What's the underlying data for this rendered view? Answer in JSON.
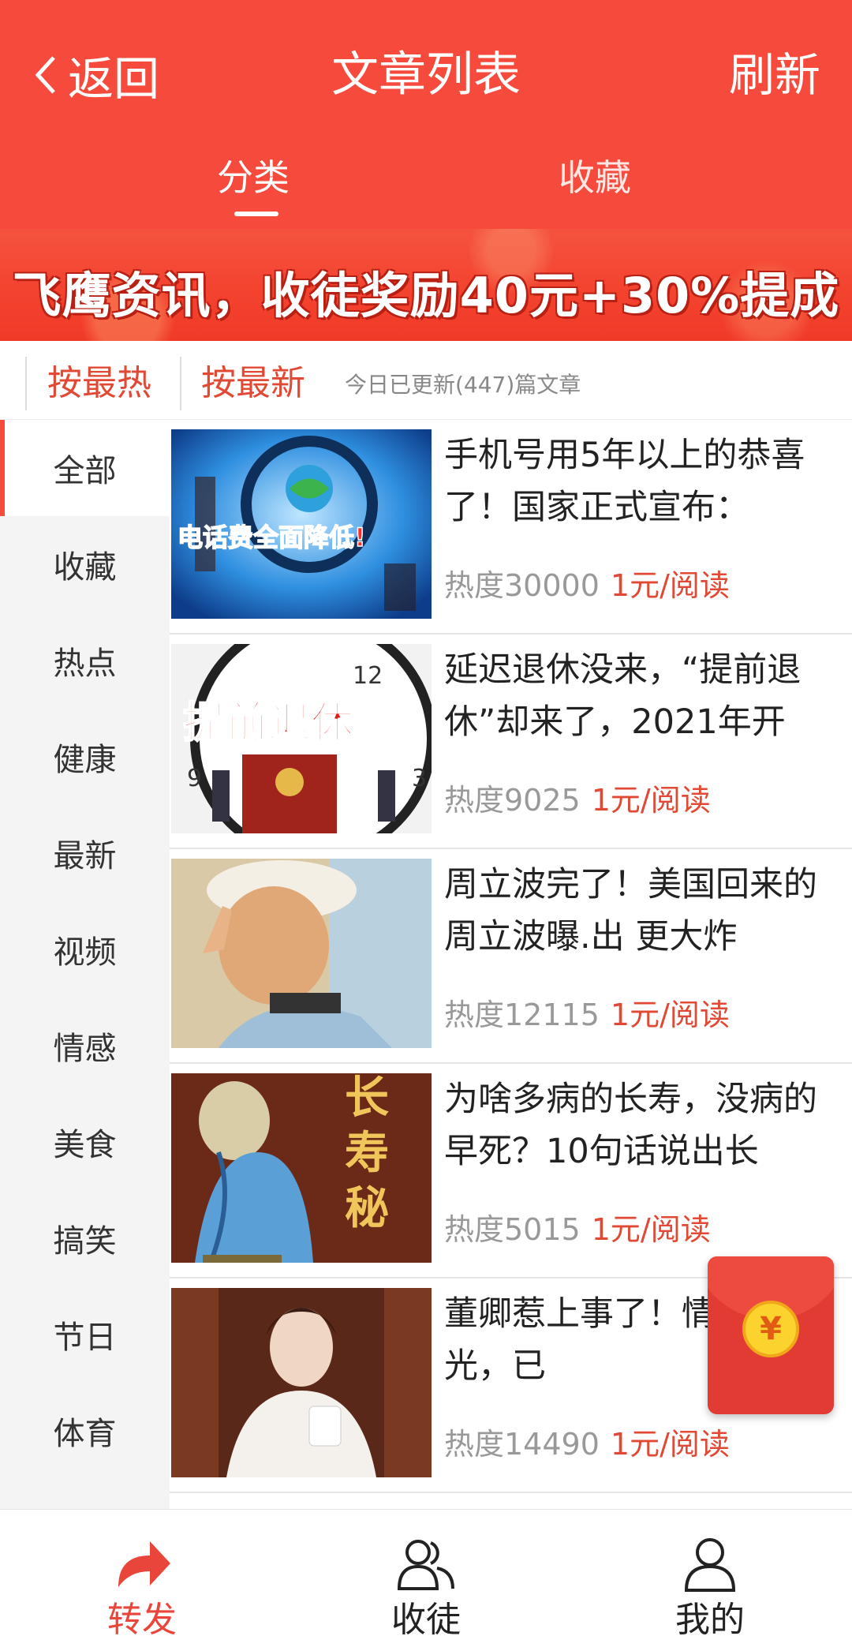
{
  "header": {
    "back_label": "返回",
    "title": "文章列表",
    "refresh_label": "刷新",
    "tabs": [
      {
        "label": "分类",
        "active": true
      },
      {
        "label": "收藏",
        "active": false
      }
    ]
  },
  "banner": {
    "text": "飞鹰资讯，收徒奖励40元+30%提成"
  },
  "sortbar": {
    "sort_hot": "按最热",
    "sort_new": "按最新",
    "update_info": "今日已更新(447)篇文章"
  },
  "sidebar": {
    "items": [
      {
        "label": "全部",
        "active": true
      },
      {
        "label": "收藏"
      },
      {
        "label": "热点"
      },
      {
        "label": "健康"
      },
      {
        "label": "最新"
      },
      {
        "label": "视频"
      },
      {
        "label": "情感"
      },
      {
        "label": "美食"
      },
      {
        "label": "搞笑"
      },
      {
        "label": "节日"
      },
      {
        "label": "体育"
      }
    ]
  },
  "articles": [
    {
      "title": "手机号用5年以上的恭喜了！国家正式宣布：",
      "heat": "热度30000",
      "price": "1元/阅读",
      "thumb_text": "电话费全面降低!"
    },
    {
      "title": "延迟退休没来，“提前退休”却来了，2021年开",
      "heat": "热度9025",
      "price": "1元/阅读",
      "thumb_text": "提前退休"
    },
    {
      "title": "周立波完了！美国回来的周立波曝.出 更大炸",
      "heat": "热度12115",
      "price": "1元/阅读"
    },
    {
      "title": "为啥多病的长寿，没病的早死？10句话说出长",
      "heat": "热度5015",
      "price": "1元/阅读",
      "thumb_text": "长寿秘诀"
    },
    {
      "title": "董卿惹上事了！情况被曝光，已",
      "heat": "热度14490",
      "price": "1元/阅读"
    }
  ],
  "redpacket": {
    "icon": "yen-coin-icon",
    "symbol": "¥"
  },
  "bottom_nav": [
    {
      "label": "转发",
      "icon": "share-arrow-icon",
      "active": true
    },
    {
      "label": "收徒",
      "icon": "users-icon",
      "active": false
    },
    {
      "label": "我的",
      "icon": "user-icon",
      "active": false
    }
  ],
  "colors": {
    "brand": "#f64a3c",
    "accent_text": "#e24935",
    "active_nav": "#e9453a"
  }
}
